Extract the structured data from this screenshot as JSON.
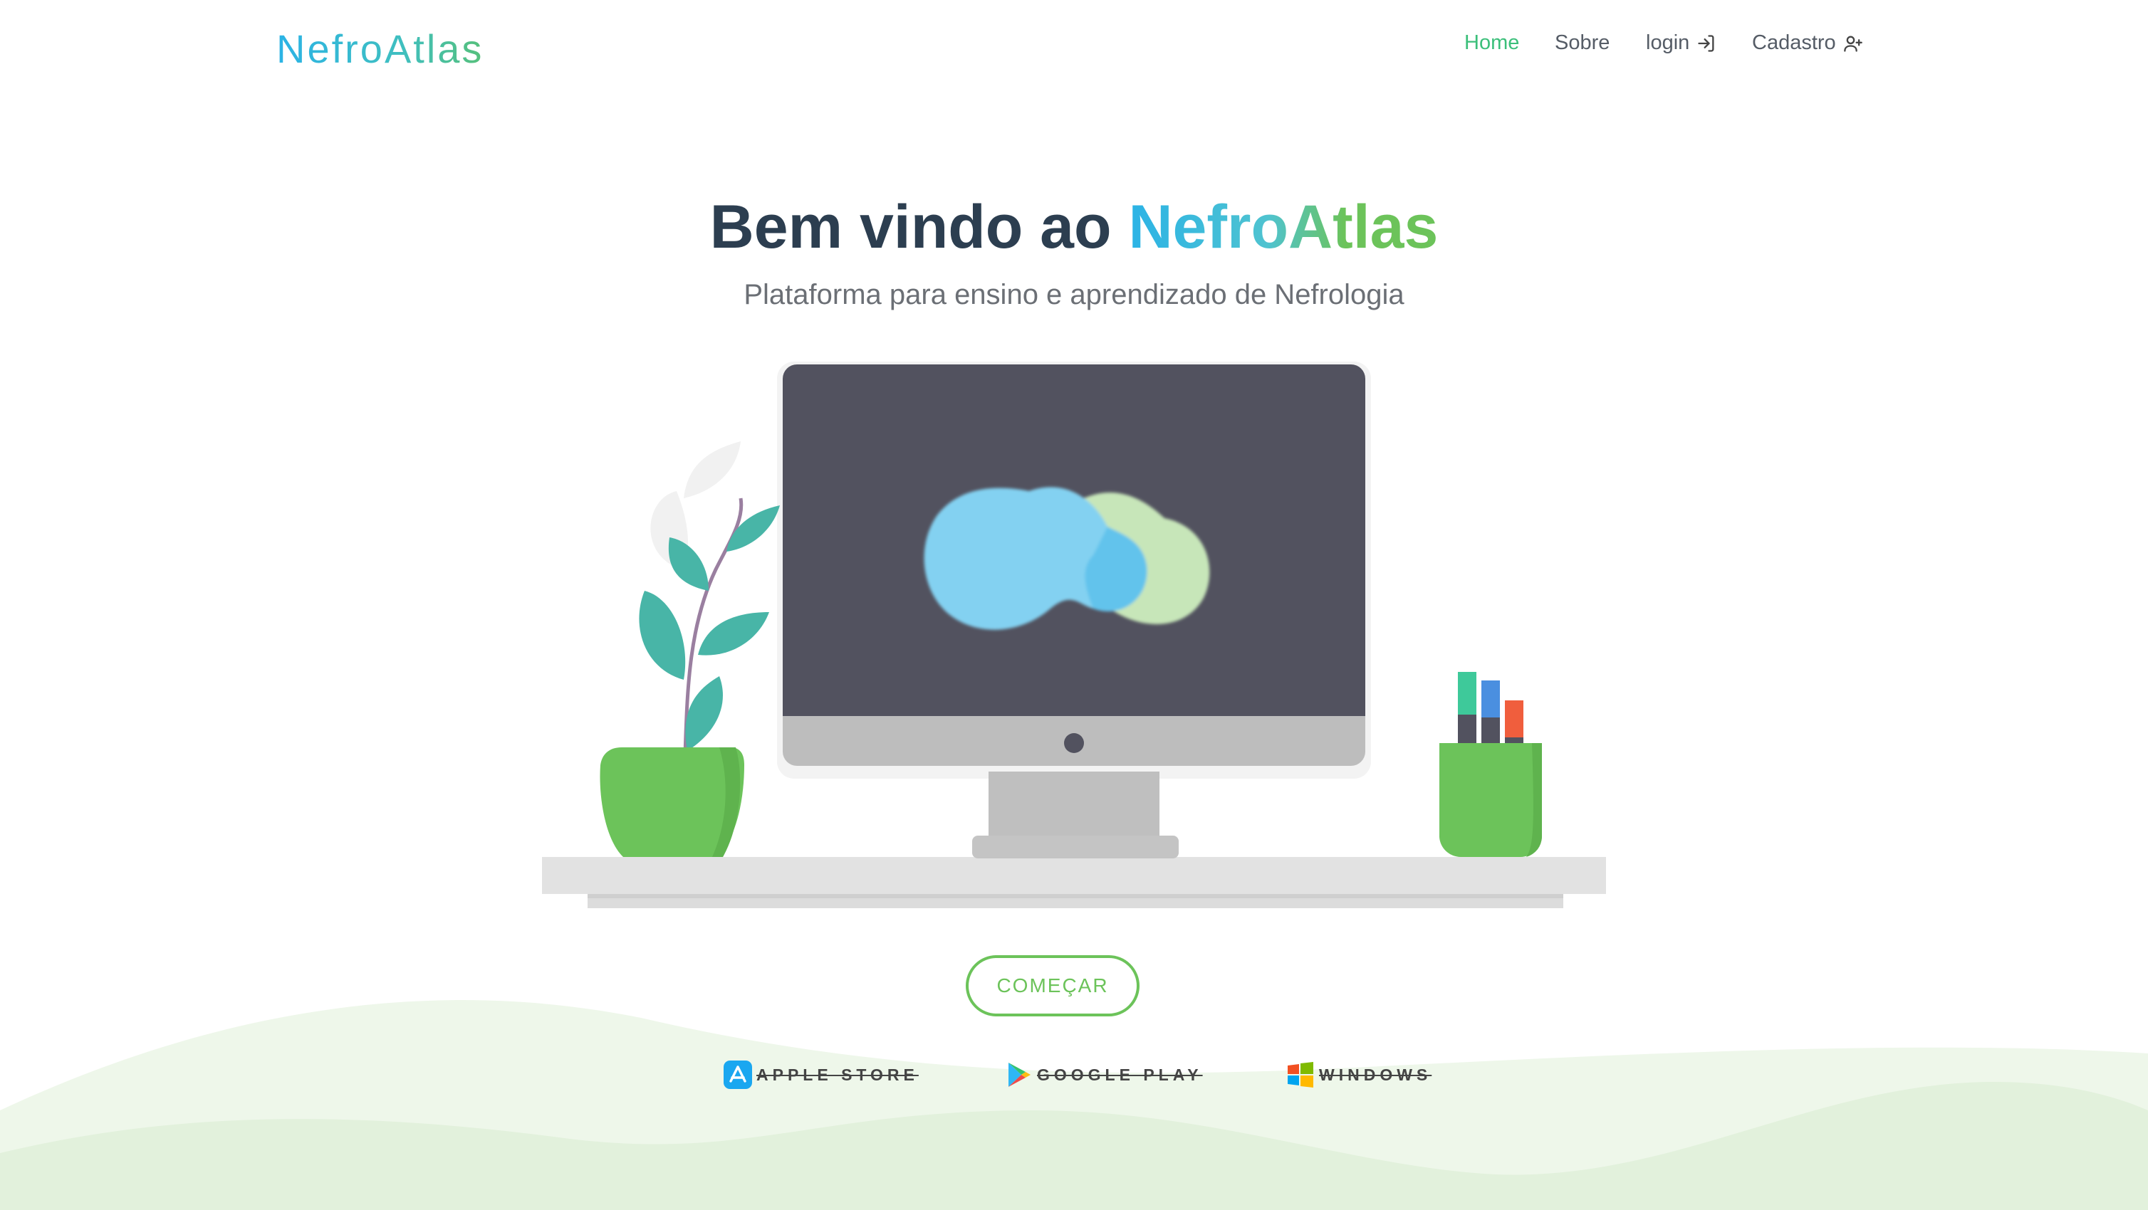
{
  "nav": {
    "brand": "NefroAtlas",
    "links": [
      {
        "label": "Home",
        "active": true
      },
      {
        "label": "Sobre",
        "active": false
      },
      {
        "label": "login",
        "icon": "login-arrow-icon"
      },
      {
        "label": "Cadastro",
        "icon": "user-plus-icon"
      }
    ]
  },
  "hero": {
    "title_prefix": "Bem vindo ao ",
    "title_accent": "NefroAtlas",
    "subtitle": "Plataforma para ensino e aprendizado de Nefrologia"
  },
  "cta": {
    "label": "COMEÇAR"
  },
  "stores": [
    {
      "label": "APPLE STORE",
      "icon": "app-store-icon"
    },
    {
      "label": "GOOGLE PLAY",
      "icon": "google-play-icon"
    },
    {
      "label": "WINDOWS",
      "icon": "windows-icon"
    }
  ],
  "colors": {
    "accent_blue": "#2bb3e6",
    "accent_green": "#6cc35a",
    "heading": "#2c3e50",
    "active_nav": "#3bbf7a"
  }
}
